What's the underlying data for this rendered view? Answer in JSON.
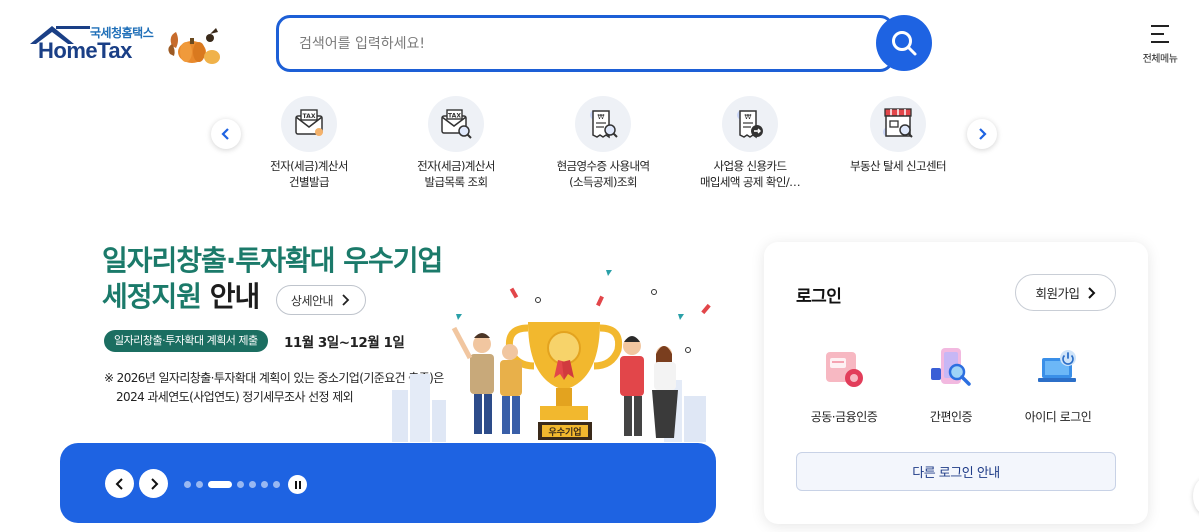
{
  "header": {
    "logo_korean": "국세청홈택스",
    "logo_english": "HomeTax",
    "search_placeholder": "검색어를 입력하세요!",
    "all_menu_label": "전체메뉴"
  },
  "quick_menu": [
    {
      "label": "전자(세금)계산서\n건별발급",
      "icon": "tax-envelope-icon"
    },
    {
      "label": "전자(세금)계산서\n발급목록 조회",
      "icon": "tax-envelope-search-icon"
    },
    {
      "label": "현금영수증 사용내역\n(소득공제)조회",
      "icon": "receipt-search-icon"
    },
    {
      "label": "사업용 신용카드\n매입세액 공제 확인/…",
      "icon": "receipt-card-icon"
    },
    {
      "label": "부동산 탈세 신고센터",
      "icon": "storefront-search-icon"
    }
  ],
  "banner": {
    "title_line1": "일자리창출·투자확대 우수기업",
    "title_line2_green": "세정지원",
    "title_line2_dark": " 안내",
    "detail_button": "상세안내",
    "pill": "일자리창출·투자확대 계획서 제출",
    "date": "11월 3일~12월 1일",
    "note_line1": "※ 2026년 일자리창출·투자확대 계획이 있는 중소기업(기준요건 충족)은",
    "note_line2": "2024 과세연도(사업연도) 정기세무조사 선정 제외",
    "trophy_label": "우수기업",
    "slide_count": 7,
    "active_slide": 3
  },
  "login": {
    "title": "로그인",
    "signup": "회원가입",
    "options": [
      {
        "label": "공동·금융인증",
        "icon": "certificate-icon"
      },
      {
        "label": "간편인증",
        "icon": "phone-search-icon"
      },
      {
        "label": "아이디 로그인",
        "icon": "laptop-power-icon"
      }
    ],
    "other_login": "다른 로그인 안내"
  },
  "colors": {
    "primary": "#1e63e2",
    "title_green": "#1b7a6a",
    "pill_green": "#1b6e61",
    "logo_navy": "#1a3f86"
  }
}
